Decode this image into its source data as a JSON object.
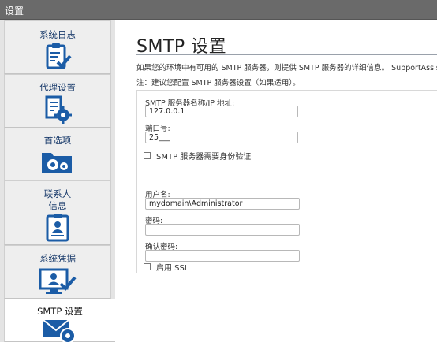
{
  "window": {
    "title": "设置"
  },
  "sidebar": {
    "items": [
      {
        "label": "系统日志",
        "icon": "system-log-icon"
      },
      {
        "label": "代理设置",
        "icon": "proxy-settings-icon"
      },
      {
        "label": "首选项",
        "icon": "preferences-icon"
      },
      {
        "label_line1": "联系人",
        "label_line2": "信息",
        "icon": "contact-info-icon"
      },
      {
        "label": "系统凭据",
        "icon": "system-credentials-icon"
      },
      {
        "label": "SMTP 设置",
        "icon": "smtp-settings-icon",
        "active": true
      }
    ]
  },
  "main": {
    "title": "SMTP 设置",
    "description": "如果您的环境中有可用的 SMTP 服务器，则提供 SMTP 服务器的详细信息。 SupportAssist 将使",
    "note": "注：建议您配置 SMTP 服务器设置（如果适用）。",
    "server_label": "SMTP 服务器名称/IP 地址:",
    "server_value": "127.0.0.1",
    "port_label": "端口号:",
    "port_value": "25___",
    "auth_checkbox_label": "SMTP 服务器需要身份验证",
    "auth_checked": false,
    "username_label": "用户名:",
    "username_value": "mydomain\\Administrator",
    "password_label": "密码:",
    "password_value": "",
    "confirm_password_label": "确认密码:",
    "confirm_password_value": "",
    "ssl_checkbox_label": "启用 SSL",
    "ssl_checked": false
  },
  "colors": {
    "accent": "#1b5ca6",
    "titlebar": "#6a6a6a",
    "sidebar": "#e4e4e4"
  }
}
